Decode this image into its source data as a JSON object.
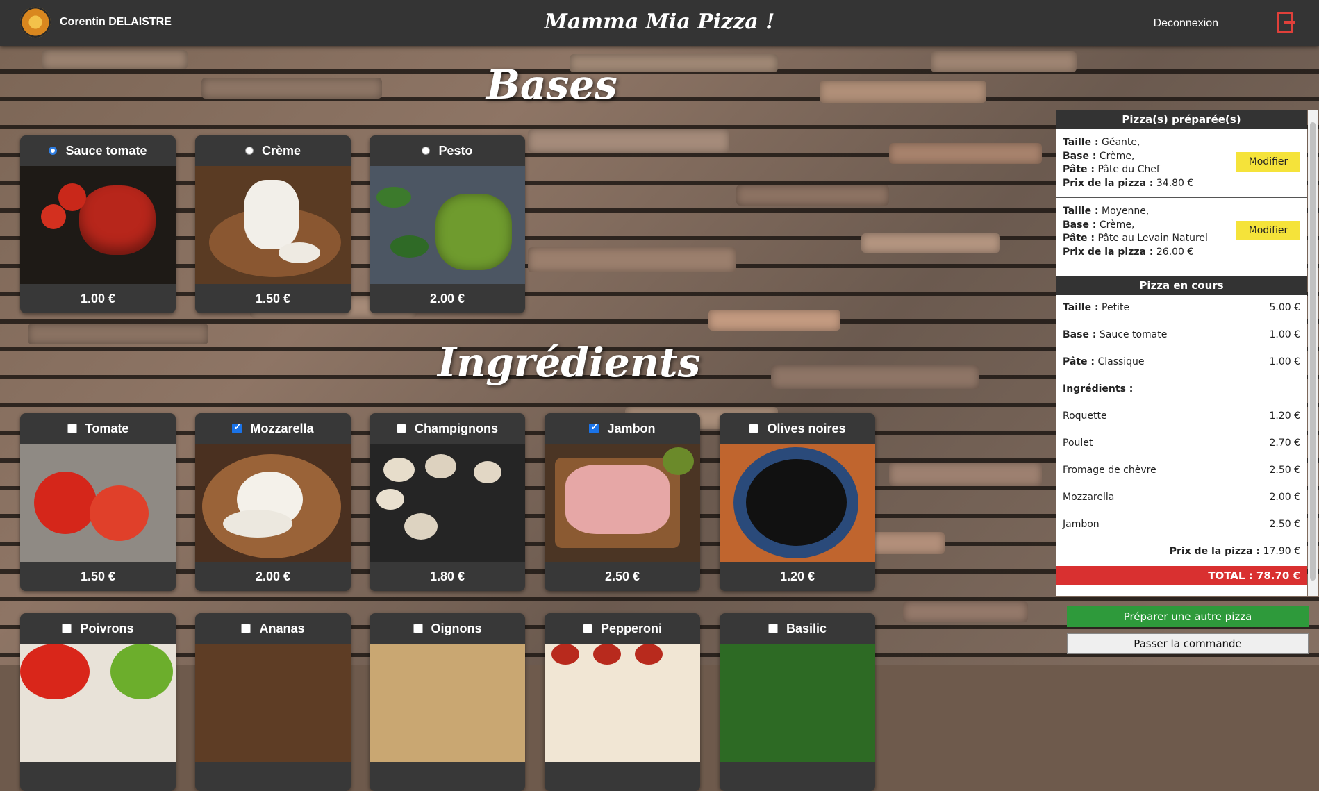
{
  "header": {
    "user_name": "Corentin DELAISTRE",
    "title": "Mamma Mia Pizza !",
    "logout_label": "Deconnexion"
  },
  "sections": {
    "bases_title": "Bases",
    "ingredients_title": "Ingrédients"
  },
  "bases": [
    {
      "label": "Sauce tomate",
      "price": "1.00 €",
      "selected": true
    },
    {
      "label": "Crème",
      "price": "1.50 €",
      "selected": false
    },
    {
      "label": "Pesto",
      "price": "2.00 €",
      "selected": false
    }
  ],
  "ingredients": [
    {
      "label": "Tomate",
      "price": "1.50 €",
      "checked": false
    },
    {
      "label": "Mozzarella",
      "price": "2.00 €",
      "checked": true
    },
    {
      "label": "Champignons",
      "price": "1.80 €",
      "checked": false
    },
    {
      "label": "Jambon",
      "price": "2.50 €",
      "checked": true
    },
    {
      "label": "Olives noires",
      "price": "1.20 €",
      "checked": false
    },
    {
      "label": "Poivrons",
      "checked": false
    },
    {
      "label": "Ananas",
      "checked": false
    },
    {
      "label": "Oignons",
      "checked": false
    },
    {
      "label": "Pepperoni",
      "checked": false
    },
    {
      "label": "Basilic",
      "checked": false
    }
  ],
  "panel": {
    "prepared_title": "Pizza(s) préparée(s)",
    "labels": {
      "size": "Taille :",
      "base": "Base :",
      "dough": "Pâte :",
      "price": "Prix de la pizza :",
      "ingredients": "Ingrédients :"
    },
    "prepared": [
      {
        "size": "Géante,",
        "base": "Crème,",
        "dough": "Pâte du Chef",
        "price": "34.80 €",
        "button": "Modifier"
      },
      {
        "size": "Moyenne,",
        "base": "Crème,",
        "dough": "Pâte au Levain Naturel",
        "price": "26.00 €",
        "button": "Modifier"
      }
    ],
    "current_title": "Pizza en cours",
    "current": {
      "size": "Petite",
      "size_price": "5.00 €",
      "base": "Sauce tomate",
      "base_price": "1.00 €",
      "dough": "Classique",
      "dough_price": "1.00 €",
      "ingredients": [
        {
          "name": "Roquette",
          "price": "1.20 €"
        },
        {
          "name": "Poulet",
          "price": "2.70 €"
        },
        {
          "name": "Fromage de chèvre",
          "price": "2.50 €"
        },
        {
          "name": "Mozzarella",
          "price": "2.00 €"
        },
        {
          "name": "Jambon",
          "price": "2.50 €"
        }
      ],
      "pizza_price": "17.90 €"
    },
    "total": "TOTAL : 78.70 €"
  },
  "actions": {
    "prepare_another": "Préparer une autre pizza",
    "place_order": "Passer la commande"
  },
  "colors": {
    "header_bg": "#343434",
    "card_bg": "#383838",
    "modify_button": "#f5e33a",
    "total_bar": "#d93030",
    "prepare_button": "#2e9a3b"
  }
}
